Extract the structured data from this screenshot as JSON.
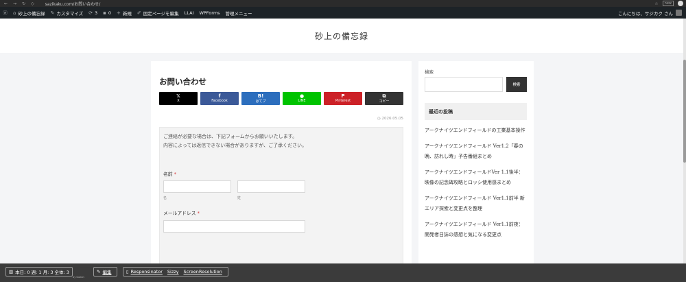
{
  "browser": {
    "url": "sazikaku.com/お問い合わせ/",
    "right_badge": "new"
  },
  "adminbar": {
    "items": [
      {
        "icon": "wordpress-icon",
        "label": ""
      },
      {
        "icon": "home-icon",
        "label": "砂上の備忘録"
      },
      {
        "icon": "brush-icon",
        "label": "カスタマイズ"
      },
      {
        "icon": "update-icon",
        "label": "3"
      },
      {
        "icon": "comment-icon",
        "label": "0"
      },
      {
        "icon": "plus-icon",
        "label": "新規"
      },
      {
        "icon": "edit-icon",
        "label": "固定ページを編集"
      },
      {
        "icon": "",
        "label": "LLAI"
      },
      {
        "icon": "",
        "label": "WPForms"
      },
      {
        "icon": "",
        "label": "管理メニュー"
      }
    ],
    "greeting": "こんにちは、サジカク さん"
  },
  "site": {
    "title": "砂上の備忘録"
  },
  "page": {
    "title": "お問い合わせ",
    "date": "2026.05.05",
    "share": [
      {
        "glyph": "𝕏",
        "label": "X",
        "color": "#000000"
      },
      {
        "glyph": "f",
        "label": "Facebook",
        "color": "#3b5998"
      },
      {
        "glyph": "B!",
        "label": "はてブ",
        "color": "#2c6ebd"
      },
      {
        "glyph": "●",
        "label": "LINE",
        "color": "#00c300"
      },
      {
        "glyph": "P",
        "label": "Pinterest",
        "color": "#cc2127"
      },
      {
        "glyph": "⧉",
        "label": "コピー",
        "color": "#333333"
      }
    ]
  },
  "form": {
    "intro_line1": "ご連絡が必要な場合は、下記フォームからお願いいたします。",
    "intro_line2": "内容によっては返信できない場合がありますが、ご了承ください。",
    "name_label": "名前",
    "first_sub": "名",
    "last_sub": "姓",
    "email_label": "メールアドレス",
    "required_mark": "*"
  },
  "sidebar": {
    "search_label": "検索",
    "search_button": "検索",
    "recent_heading": "最近の投稿",
    "posts": [
      "アークナイツエンドフィールドの工業基本操作",
      "アークナイツエンドフィールド Ver1.2「春の晩、訪れし時」予告番組まとめ",
      "アークナイツエンドフィールドVer 1.1後半：映像の記念碑攻略とロッシ使用感まとめ",
      "アークナイツエンドフィールド Ver1.1前半 新エリア探索と変更点を整理",
      "アークナイツエンドフィールド Ver1.1前夜：開発者日誌の感想と気になる変更点"
    ]
  },
  "bottombar": {
    "stats": "本日: 0  週: 1  月: 3  全体: 3",
    "by": "by Goeon",
    "edit": "編集",
    "links": [
      "Responsinator",
      "Sizzy",
      "ScreenResolution"
    ]
  }
}
